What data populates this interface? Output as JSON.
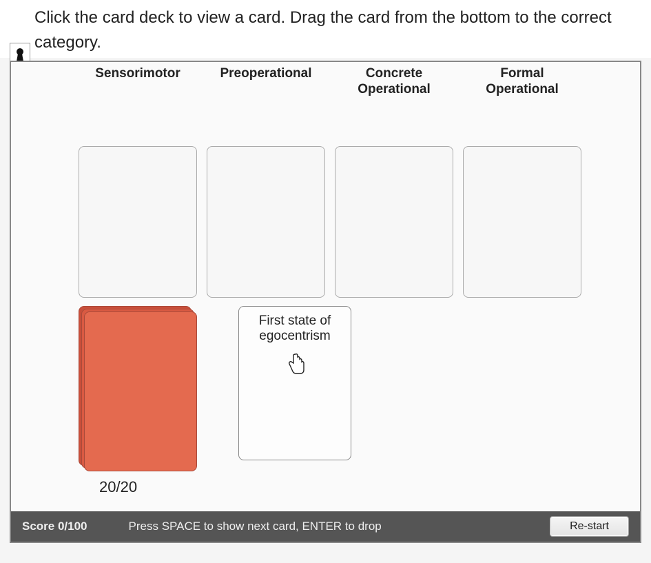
{
  "instructions": "Click the card deck to view a card. Drag the card from the bottom to the correct category.",
  "categories": [
    {
      "label": "Sensorimotor"
    },
    {
      "label": "Preoperational"
    },
    {
      "label": "Concrete Operational"
    },
    {
      "label": "Formal Operational"
    }
  ],
  "deck": {
    "count_label": "20/20"
  },
  "drawn_card": {
    "text": "First state of egocentrism"
  },
  "status": {
    "score_label": "Score 0/100",
    "hint": "Press SPACE to show next card, ENTER to drop",
    "restart_label": "Re-start"
  }
}
